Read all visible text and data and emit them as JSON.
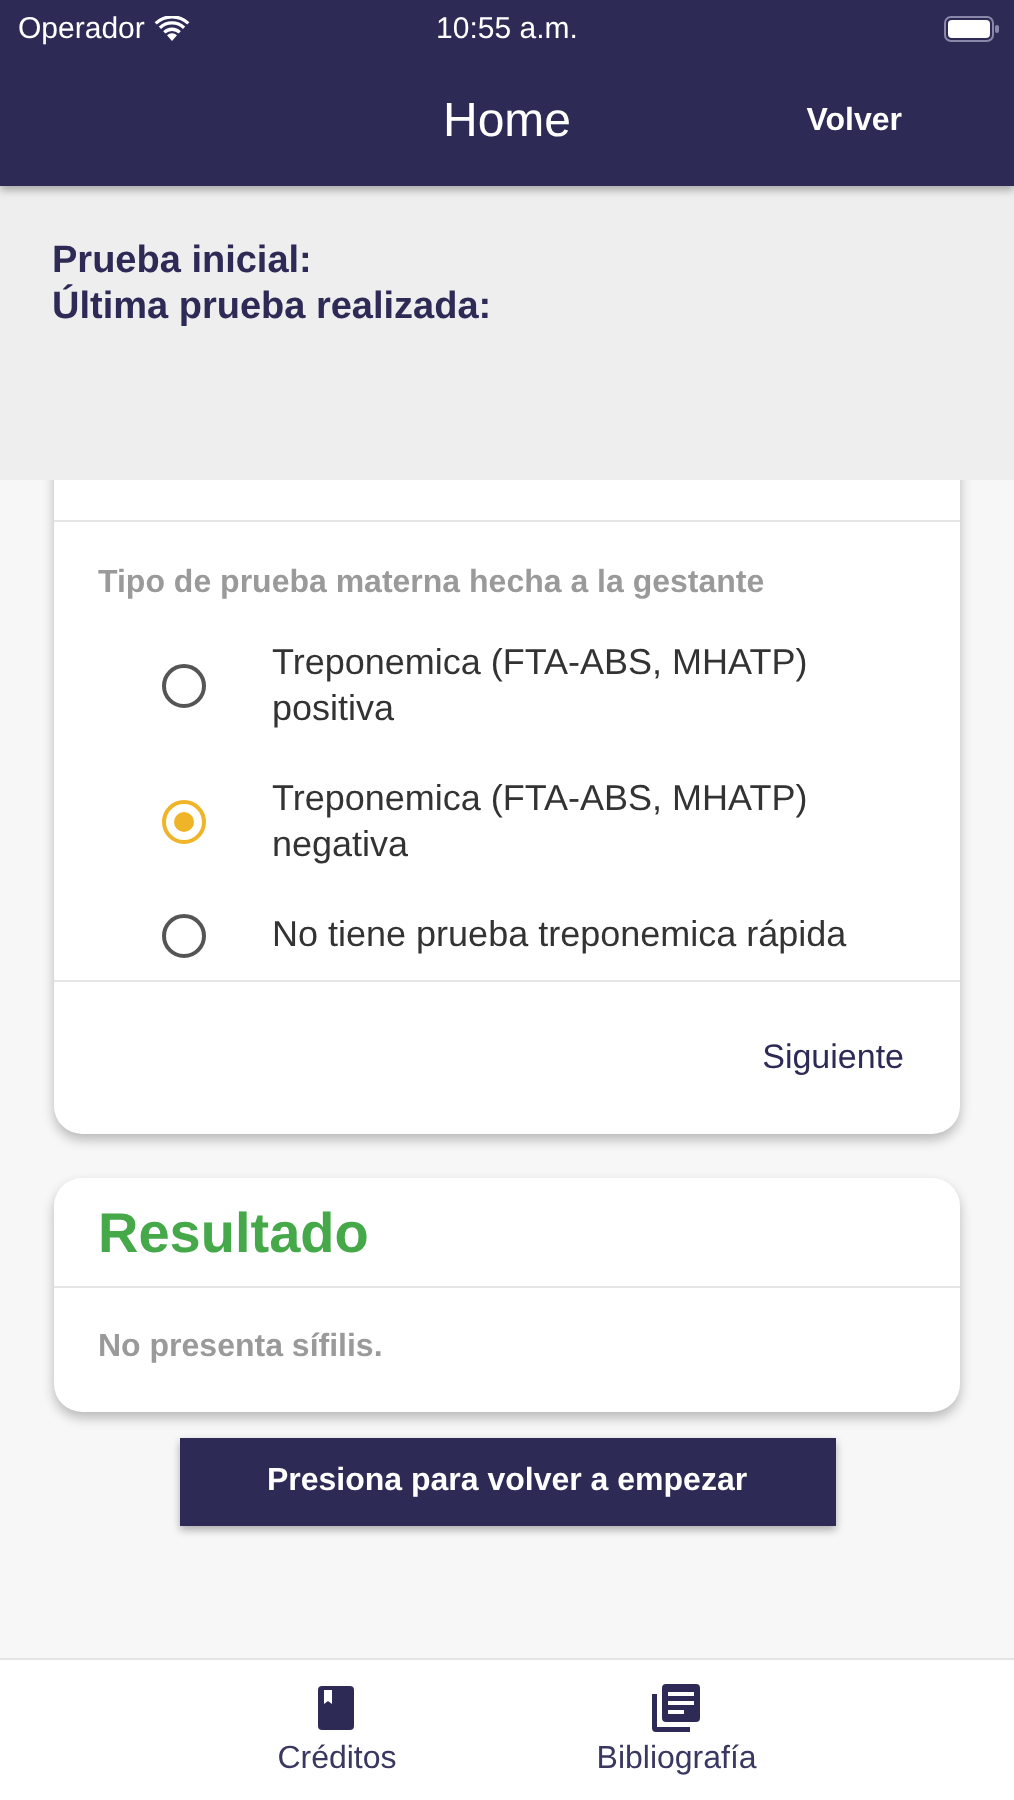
{
  "status_bar": {
    "carrier": "Operador",
    "time": "10:55 a.m."
  },
  "nav_bar": {
    "title": "Home",
    "action": "Volver"
  },
  "summary": {
    "lines": [
      "Prueba inicial:",
      "Última prueba realizada:"
    ]
  },
  "question_card": {
    "prompt": "Tipo de prueba materna hecha a la gestante",
    "options": [
      {
        "label": "Treponemica (FTA-ABS, MHATP) positiva",
        "selected": false
      },
      {
        "label": "Treponemica (FTA-ABS, MHATP) negativa",
        "selected": true
      },
      {
        "label": "No tiene prueba treponemica rápida",
        "selected": false
      }
    ],
    "next": "Siguiente"
  },
  "result_card": {
    "title": "Resultado",
    "text": "No presenta sífilis."
  },
  "restart_button": "Presiona para volver a empezar",
  "tab_bar": [
    {
      "label": "Créditos",
      "kind": "book"
    },
    {
      "label": "Bibliografía",
      "kind": "library"
    }
  ]
}
